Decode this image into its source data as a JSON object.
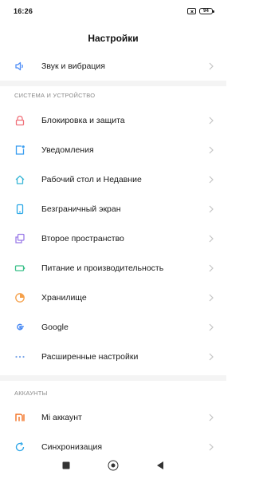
{
  "status_bar": {
    "time": "16:26",
    "battery": "94"
  },
  "header": {
    "title": "Настройки"
  },
  "sections": [
    {
      "header": "СИСТЕМА И УСТРОЙСТВО"
    },
    {
      "header": "АККАУНТЫ"
    }
  ],
  "items": {
    "sound": {
      "label": "Звук и вибрация",
      "icon": "speaker-icon",
      "color": "#4f8ef7"
    },
    "lock": {
      "label": "Блокировка и защита",
      "icon": "lock-icon",
      "color": "#f0717a"
    },
    "notifications": {
      "label": "Уведомления",
      "icon": "notification-icon",
      "color": "#3a9ef0"
    },
    "desktop": {
      "label": "Рабочий стол и Недавние",
      "icon": "home-icon",
      "color": "#39b6d6"
    },
    "fullscreen": {
      "label": "Безграничный экран",
      "icon": "phone-icon",
      "color": "#29a7e6"
    },
    "second_space": {
      "label": "Второе пространство",
      "icon": "second-space-icon",
      "color": "#9b7be8"
    },
    "battery": {
      "label": "Питание и производительность",
      "icon": "battery-icon",
      "color": "#3cc08a"
    },
    "storage": {
      "label": "Хранилище",
      "icon": "storage-icon",
      "color": "#f5a04a"
    },
    "google": {
      "label": "Google",
      "icon": "google-icon",
      "color": "#4285f4"
    },
    "advanced": {
      "label": "Расширенные настройки",
      "icon": "more-dots-icon",
      "color": "#7aa6e8"
    },
    "mi_account": {
      "label": "Mi аккаунт",
      "icon": "mi-icon",
      "color": "#f37021"
    },
    "sync": {
      "label": "Синхронизация",
      "icon": "sync-icon",
      "color": "#2fa7e8"
    }
  },
  "nav": {
    "buttons": [
      "recents",
      "home",
      "back"
    ]
  }
}
